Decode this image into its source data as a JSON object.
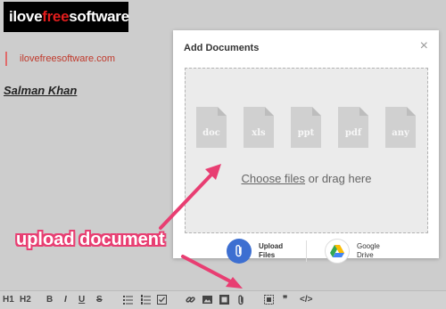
{
  "logo": {
    "part1": "ilove",
    "part2": "free",
    "part3": "software"
  },
  "page": {
    "site_text": "ilovefreesoftware.com",
    "author": "Salman Khan"
  },
  "modal": {
    "title": "Add Documents",
    "close": "×",
    "file_types": [
      "doc",
      "xls",
      "ppt",
      "pdf",
      "any"
    ],
    "choose_link": "Choose files",
    "choose_rest": " or drag here",
    "sources": [
      {
        "line1": "Upload",
        "line2": "Files"
      },
      {
        "line1": "Google",
        "line2": "Drive"
      }
    ]
  },
  "annotation": {
    "text": "upload document",
    "color": "#e83e72"
  },
  "toolbar": {
    "h1": "H1",
    "h2": "H2",
    "bold": "B",
    "italic": "I",
    "underline": "U",
    "strike": "S",
    "quote": "❞",
    "code": "</>"
  }
}
